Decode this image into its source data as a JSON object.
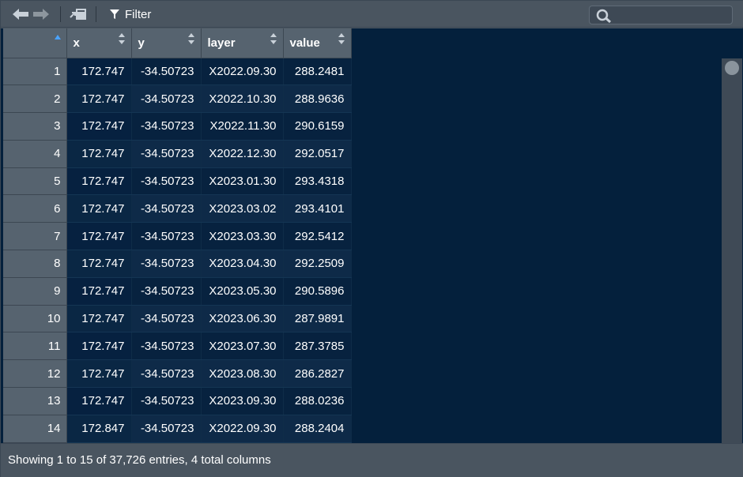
{
  "toolbar": {
    "back_icon": "arrow-left-icon",
    "forward_icon": "arrow-right-icon",
    "open_icon": "open-in-window-icon",
    "filter_label": "Filter",
    "search_placeholder": ""
  },
  "table": {
    "columns": [
      "x",
      "y",
      "layer",
      "value"
    ],
    "rows": [
      {
        "n": "1",
        "x": "172.747",
        "y": "-34.50723",
        "layer": "X2022.09.30",
        "value": "288.2481"
      },
      {
        "n": "2",
        "x": "172.747",
        "y": "-34.50723",
        "layer": "X2022.10.30",
        "value": "288.9636"
      },
      {
        "n": "3",
        "x": "172.747",
        "y": "-34.50723",
        "layer": "X2022.11.30",
        "value": "290.6159"
      },
      {
        "n": "4",
        "x": "172.747",
        "y": "-34.50723",
        "layer": "X2022.12.30",
        "value": "292.0517"
      },
      {
        "n": "5",
        "x": "172.747",
        "y": "-34.50723",
        "layer": "X2023.01.30",
        "value": "293.4318"
      },
      {
        "n": "6",
        "x": "172.747",
        "y": "-34.50723",
        "layer": "X2023.03.02",
        "value": "293.4101"
      },
      {
        "n": "7",
        "x": "172.747",
        "y": "-34.50723",
        "layer": "X2023.03.30",
        "value": "292.5412"
      },
      {
        "n": "8",
        "x": "172.747",
        "y": "-34.50723",
        "layer": "X2023.04.30",
        "value": "292.2509"
      },
      {
        "n": "9",
        "x": "172.747",
        "y": "-34.50723",
        "layer": "X2023.05.30",
        "value": "290.5896"
      },
      {
        "n": "10",
        "x": "172.747",
        "y": "-34.50723",
        "layer": "X2023.06.30",
        "value": "287.9891"
      },
      {
        "n": "11",
        "x": "172.747",
        "y": "-34.50723",
        "layer": "X2023.07.30",
        "value": "287.3785"
      },
      {
        "n": "12",
        "x": "172.747",
        "y": "-34.50723",
        "layer": "X2023.08.30",
        "value": "286.2827"
      },
      {
        "n": "13",
        "x": "172.747",
        "y": "-34.50723",
        "layer": "X2023.09.30",
        "value": "288.0236"
      },
      {
        "n": "14",
        "x": "172.847",
        "y": "-34.50723",
        "layer": "X2022.09.30",
        "value": "288.2404"
      }
    ]
  },
  "footer": {
    "status": "Showing 1 to 15 of 37,726 entries, 4 total columns"
  },
  "colors": {
    "grid_background": "#04203c",
    "chrome": "#4a5560",
    "header": "#56636f"
  }
}
